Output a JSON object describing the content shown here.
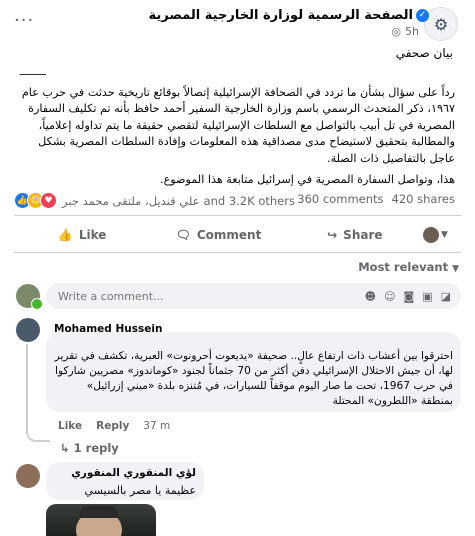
{
  "post": {
    "page_name": "الصفحة الرسمية لوزارة الخارجية المصرية",
    "time": "5h",
    "title": "بيان صحفي",
    "paragraph1": "رداً على سؤال بشأن ما تردد في الصحافة الإسرائيلية إتصالاً بوقائع تاريخية حدثت في حرب عام ١٩٦٧، ذكر المتحدث الرسمي باسم وزارة الخارجية السفير أحمد حافظ بأنه تم تكليف السفارة المصرية في تل أبيب بالتواصل مع السلطات الإسرائيلية لتقصي حقيقة ما يتم تداوله إعلامياً، والمطالبة بتحقيق لاستيضاح مدى مصداقية هذه المعلومات وإفادة السلطات المصرية بشكل عاجل بالتفاصيل ذات الصلة.",
    "paragraph2": "هذا، وتواصل السفارة المصرية في إسرائيل متابعة هذا الموضوع."
  },
  "reactions": {
    "summary_names": "علي قنديل، ملتقى محمد جبر",
    "summary_others": "and 3.2K others",
    "comments": "360 comments",
    "shares": "420 shares"
  },
  "actions": {
    "like": "Like",
    "comment": "Comment",
    "share": "Share"
  },
  "sort": {
    "label": "Most relevant"
  },
  "composer": {
    "placeholder": "Write a comment..."
  },
  "comments": [
    {
      "author": "Mohamed Hussein",
      "text": "احترقوا بين أعشاب ذات ارتفاع عالٍ.. صحيفة «يديعوت أحرونوت» العبرية، تكشف في تقرير لها، أن جيش الاحتلال الإسرائيلي دفن أكثر من 70 جثماناً لجنود «كوماندوز» مصريين شاركوا في حرب 1967، تحت ما صار اليوم موقفاً للسيارات، في مُتنزه بلدة «ميني إزرائيل» بمنطقة «اللطرون» المحتلة",
      "like": "Like",
      "reply": "Reply",
      "time": "37 m",
      "replies_label": "1 reply"
    },
    {
      "author": "لؤي المنقوري المنقوري",
      "text": "عظيمة يا مصر بالسيسي"
    }
  ],
  "colors": {
    "accent": "#1877f2",
    "muted": "#65676b",
    "bubble": "#f0f2f5",
    "like": "#1877f2",
    "love": "#f33e58",
    "care": "#f7b125"
  }
}
